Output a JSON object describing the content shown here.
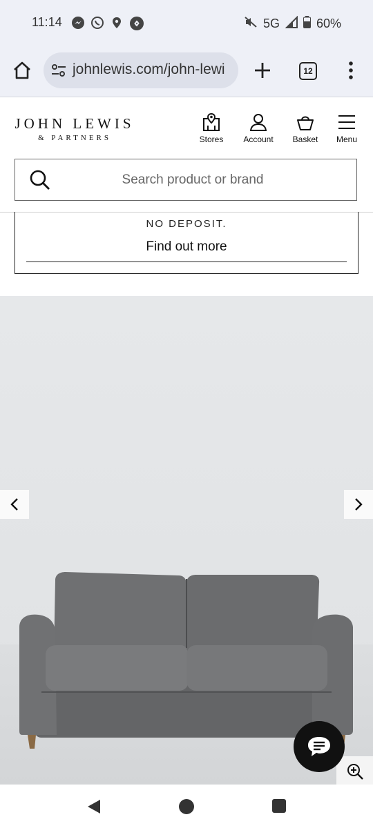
{
  "status": {
    "time": "11:14",
    "network": "5G",
    "battery": "60%",
    "icons": [
      "messenger-icon",
      "whatsapp-icon",
      "location-icon",
      "shazam-icon",
      "mute-icon",
      "signal-icon",
      "battery-icon"
    ]
  },
  "browser": {
    "url": "johnlewis.com/john-lewi",
    "tab_count": "12"
  },
  "header": {
    "logo_line1": "JOHN LEWIS",
    "logo_line2": "& PARTNERS",
    "nav": {
      "stores": "Stores",
      "account": "Account",
      "basket": "Basket",
      "menu": "Menu"
    },
    "search_placeholder": "Search product or brand"
  },
  "promo": {
    "text": "NO DEPOSIT.",
    "link": "Find out more"
  },
  "gallery": {
    "product_image": "grey-two-seater-sofa",
    "colors": {
      "sofa": "#6d6e70",
      "legs": "#8a6a45"
    }
  }
}
